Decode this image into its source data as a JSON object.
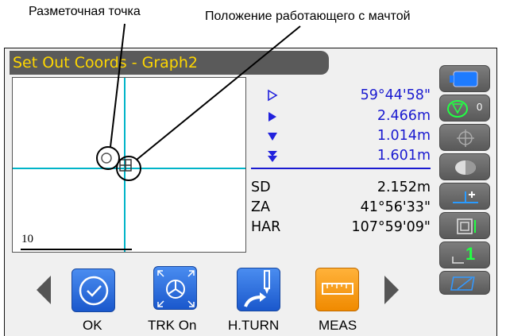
{
  "callouts": {
    "target_point": "Разметочная точка",
    "staff_position": "Положение работающего с мачтой"
  },
  "screen": {
    "title": "Set Out Coords - Graph2"
  },
  "graph": {
    "scale": "10"
  },
  "readings": {
    "angle": "59°44'58\"",
    "dist_horizontal": "2.466m",
    "dist_down": "1.014m",
    "dist_vertical": "1.601m",
    "sd_label": "SD",
    "sd_value": "2.152m",
    "za_label": "ZA",
    "za_value": "41°56'33\"",
    "har_label": "HAR",
    "har_value": "107°59'09\""
  },
  "side": {
    "target_const": "0",
    "page_num": "1"
  },
  "softkeys": {
    "ok": "OK",
    "trk_on": "TRK On",
    "h_turn": "H.TURN",
    "meas": "MEAS"
  },
  "icons": {
    "battery": "battery-icon",
    "target": "prism-target-icon",
    "laser": "laser-pointer-icon",
    "illumination": "illumination-icon",
    "tilt": "tilt-correction-icon",
    "mode": "input-mode-icon",
    "page": "page-number-icon",
    "bluetooth": "communication-icon"
  },
  "colors": {
    "title_text": "#ffd700",
    "value_blue": "#1a1ad0",
    "crosshair": "#00b4c8",
    "softkey_blue": "#1a58cc",
    "softkey_orange": "#f08a00"
  }
}
